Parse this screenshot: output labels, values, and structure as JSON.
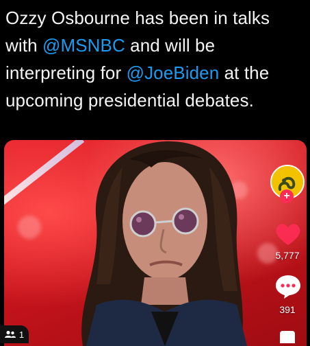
{
  "post": {
    "text_part1": "Ozzy Osbourne has been in talks with ",
    "mention1": "@MSNBC",
    "text_part2": " and will be interpreting for ",
    "mention2": "@JoeBiden",
    "text_part3": " at the upcoming presidential debates."
  },
  "video": {
    "likes": "5,777",
    "comments": "391",
    "viewers": "1"
  },
  "icons": {
    "follow": "plus-icon",
    "like": "heart-icon",
    "comment": "comment-icon",
    "viewers": "people-icon"
  },
  "colors": {
    "mention": "#1d9bf0",
    "heart": "#fe2c55",
    "background": "#000000"
  }
}
